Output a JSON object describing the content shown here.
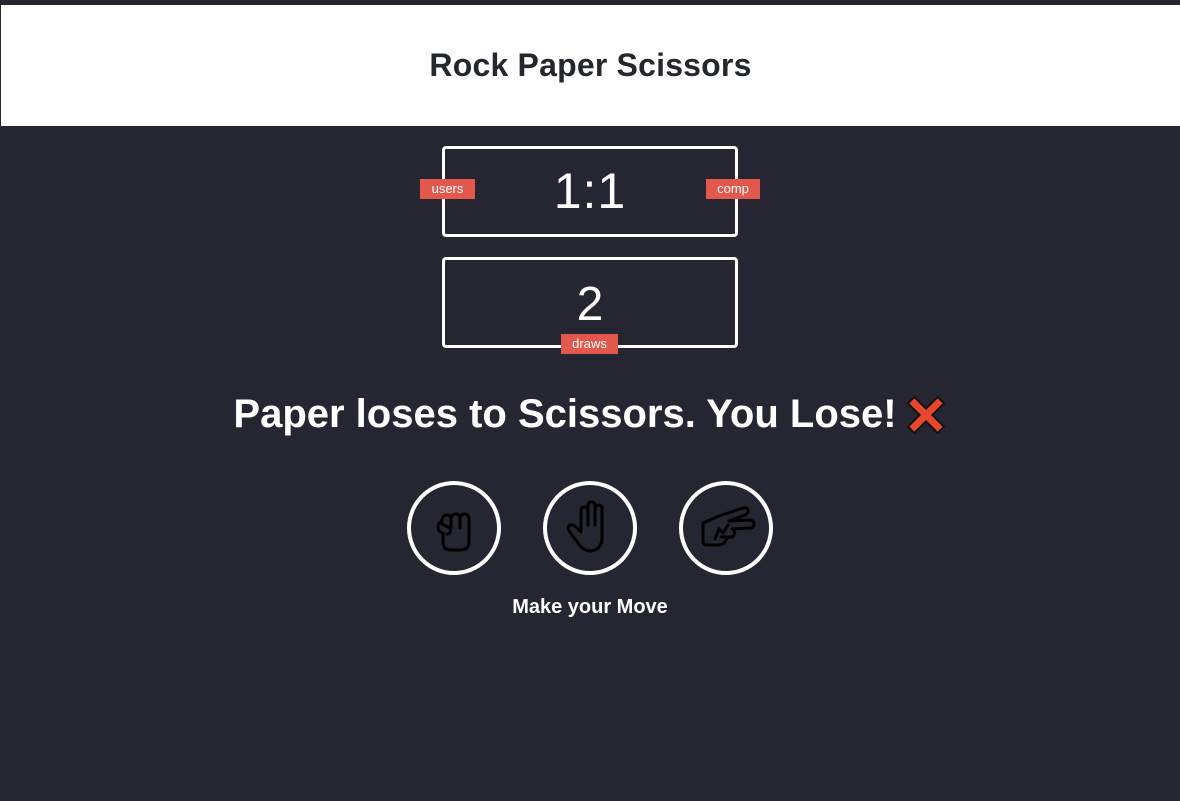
{
  "header": {
    "title": "Rock Paper Scissors"
  },
  "scoreboard": {
    "score": "1:1",
    "user_label": "users",
    "comp_label": "comp"
  },
  "draws": {
    "value": "2",
    "label": "draws"
  },
  "result": {
    "message": "Paper loses to Scissors. You Lose!",
    "icon": "cross-mark-icon"
  },
  "choices": [
    {
      "name": "rock",
      "icon": "rock-hand-icon"
    },
    {
      "name": "paper",
      "icon": "paper-hand-icon"
    },
    {
      "name": "scissors",
      "icon": "scissors-hand-icon"
    }
  ],
  "action": {
    "message": "Make your Move"
  },
  "colors": {
    "background": "#252632",
    "header_bg": "#ffffff",
    "badge": "#e2584d",
    "text_light": "#ffffff",
    "text_dark": "#24272b"
  }
}
